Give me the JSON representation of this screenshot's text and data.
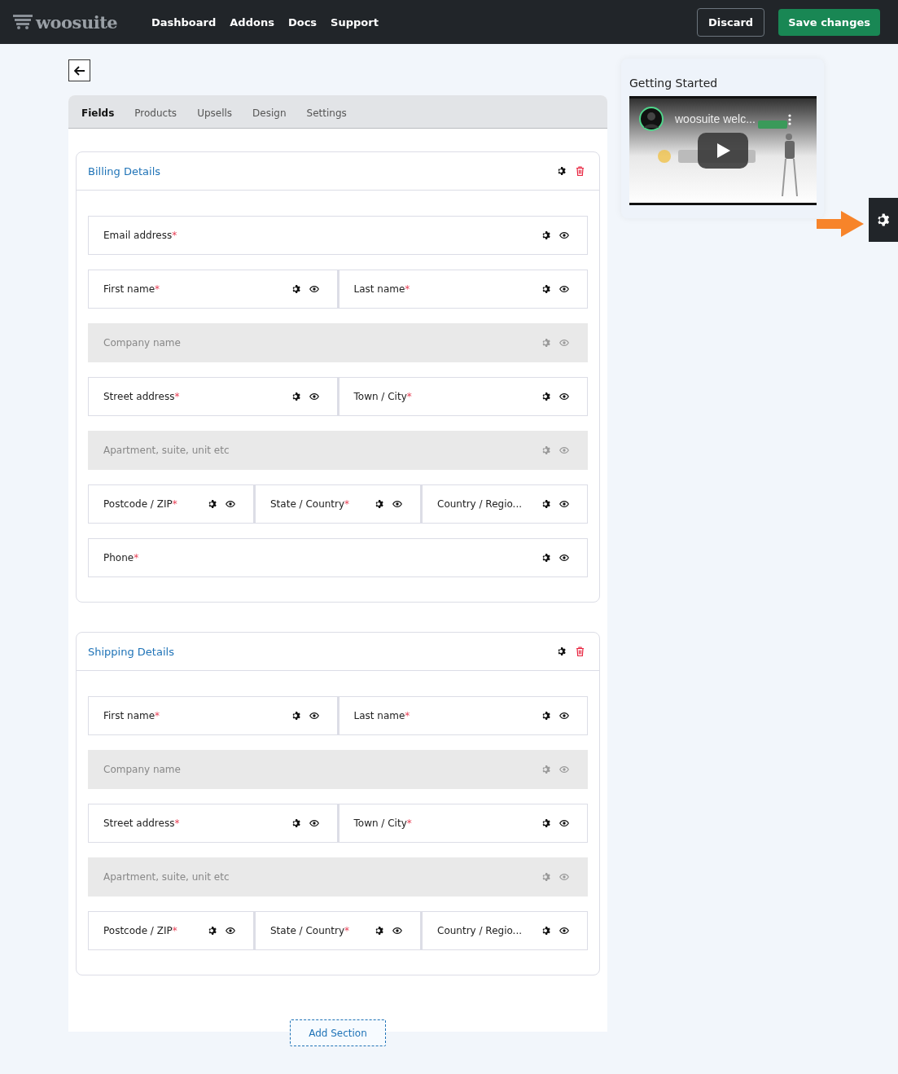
{
  "brand": {
    "name": "woosuite"
  },
  "nav": [
    "Dashboard",
    "Addons",
    "Docs",
    "Support"
  ],
  "actions": {
    "discard": "Discard",
    "save": "Save changes"
  },
  "tabs": [
    {
      "label": "Fields",
      "selected": true
    },
    {
      "label": "Products",
      "selected": false
    },
    {
      "label": "Upsells",
      "selected": false
    },
    {
      "label": "Design",
      "selected": false
    },
    {
      "label": "Settings",
      "selected": false
    }
  ],
  "sections": [
    {
      "title": "Billing Details",
      "rows": [
        [
          {
            "label": "Email address",
            "asterisk": "*",
            "disabled": false
          }
        ],
        [
          {
            "label": "First name",
            "asterisk": "*",
            "disabled": false
          },
          {
            "label": "Last name",
            "asterisk": "*",
            "disabled": false
          }
        ],
        [
          {
            "label": "Company name",
            "disabled": true
          }
        ],
        [
          {
            "label": "Street address",
            "asterisk": "*",
            "disabled": false
          },
          {
            "label": "Town / City",
            "asterisk": "*",
            "disabled": false
          }
        ],
        [
          {
            "label": "Apartment, suite, unit etc",
            "disabled": true
          }
        ],
        [
          {
            "label": "Postcode / ZIP",
            "asterisk": "*",
            "disabled": false
          },
          {
            "label": "State / Country",
            "asterisk": "*",
            "disabled": false
          },
          {
            "label": "Country / Regio...",
            "disabled": false
          }
        ],
        [
          {
            "label": "Phone",
            "asterisk": "*",
            "disabled": false
          }
        ]
      ]
    },
    {
      "title": "Shipping Details",
      "rows": [
        [
          {
            "label": "First name",
            "asterisk": "*",
            "disabled": false
          },
          {
            "label": "Last name",
            "asterisk": "*",
            "disabled": false
          }
        ],
        [
          {
            "label": "Company name",
            "disabled": true
          }
        ],
        [
          {
            "label": "Street address",
            "asterisk": "*",
            "disabled": false
          },
          {
            "label": "Town / City",
            "asterisk": "*",
            "disabled": false
          }
        ],
        [
          {
            "label": "Apartment, suite, unit etc",
            "disabled": true
          }
        ],
        [
          {
            "label": "Postcode / ZIP",
            "asterisk": "*",
            "disabled": false
          },
          {
            "label": "State / Country",
            "asterisk": "*",
            "disabled": false
          },
          {
            "label": "Country / Regio...",
            "disabled": false
          }
        ]
      ]
    }
  ],
  "add_section": "Add Section",
  "getting_started": {
    "title": "Getting Started",
    "video_title": "woosuite welc..."
  }
}
